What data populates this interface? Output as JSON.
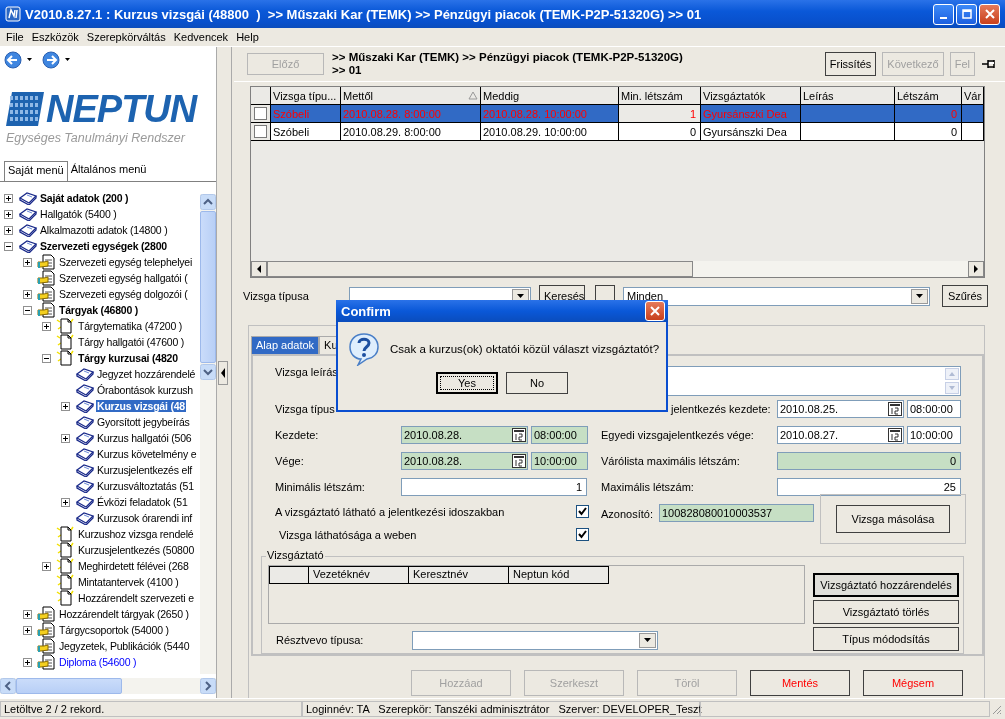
{
  "window": {
    "title": "V2010.8.27.1 : Kurzus vizsgái (48800  )  >> Műszaki Kar (TEMK) >> Pénzügyi piacok (TEMK-P2P-51320G) >> 01"
  },
  "menu": [
    "File",
    "Eszközök",
    "Szerepkörváltás",
    "Kedvencek",
    "Help"
  ],
  "logo": {
    "name": "NEPTUN",
    "tagline": "Egységes Tanulmányi Rendszer"
  },
  "menu_tabs": [
    {
      "label": "Saját menü",
      "selected": true
    },
    {
      "label": "Általános menü",
      "selected": false
    }
  ],
  "tree": [
    {
      "label": "Saját adatok (200  )",
      "kind": "book",
      "bold": true,
      "link": false,
      "expandable": true,
      "expanded": false,
      "selected": false
    },
    {
      "label": "Hallgatók (5400  )",
      "kind": "book",
      "bold": false,
      "link": false,
      "expandable": true,
      "expanded": false,
      "selected": false
    },
    {
      "label": "Alkalmazotti adatok (14800  )",
      "kind": "book",
      "bold": false,
      "link": false,
      "expandable": true,
      "expanded": false,
      "selected": false
    },
    {
      "label": "Szervezeti egységek (2800",
      "kind": "book",
      "bold": true,
      "link": false,
      "expandable": true,
      "expanded": true,
      "selected": false,
      "children": [
        {
          "label": "Szervezeti egység telephelyei",
          "kind": "doc-hand",
          "bold": false,
          "link": false,
          "expandable": true,
          "expanded": false,
          "selected": false
        },
        {
          "label": "Szervezeti egység hallgatói (",
          "kind": "doc-hand",
          "bold": false,
          "link": false,
          "expandable": false,
          "selected": false
        },
        {
          "label": "Szervezeti egység dolgozói (",
          "kind": "doc-hand",
          "bold": false,
          "link": false,
          "expandable": true,
          "expanded": false,
          "selected": false
        },
        {
          "label": "Tárgyak (46800  )",
          "kind": "doc-hand",
          "bold": true,
          "link": false,
          "expandable": true,
          "expanded": true,
          "selected": false,
          "children": [
            {
              "label": "Tárgytematika (47200  )",
              "kind": "page",
              "bold": false,
              "link": false,
              "expandable": true,
              "expanded": false,
              "selected": false
            },
            {
              "label": "Tárgy hallgatói (47600  )",
              "kind": "page",
              "bold": false,
              "link": false,
              "expandable": false,
              "selected": false
            },
            {
              "label": "Tárgy kurzusai (4820",
              "kind": "page",
              "bold": true,
              "link": false,
              "expandable": true,
              "expanded": true,
              "selected": false,
              "children": [
                {
                  "label": "Jegyzet hozzárendelé",
                  "kind": "book",
                  "bold": false,
                  "link": false,
                  "expandable": false,
                  "selected": false
                },
                {
                  "label": "Órabontások kurzush",
                  "kind": "book",
                  "bold": false,
                  "link": false,
                  "expandable": false,
                  "selected": false
                },
                {
                  "label": "Kurzus vizsgái (48",
                  "kind": "book",
                  "bold": true,
                  "link": false,
                  "expandable": true,
                  "expanded": false,
                  "selected": true
                },
                {
                  "label": "Gyorsított jegybeírás",
                  "kind": "book",
                  "bold": false,
                  "link": false,
                  "expandable": false,
                  "selected": false
                },
                {
                  "label": "Kurzus hallgatói (506",
                  "kind": "book",
                  "bold": false,
                  "link": false,
                  "expandable": true,
                  "expanded": false,
                  "selected": false
                },
                {
                  "label": "Kurzus követelmény e",
                  "kind": "book",
                  "bold": false,
                  "link": false,
                  "expandable": false,
                  "selected": false
                },
                {
                  "label": "Kurzusjelentkezés elf",
                  "kind": "book",
                  "bold": false,
                  "link": false,
                  "expandable": false,
                  "selected": false
                },
                {
                  "label": "Kurzusváltoztatás (51",
                  "kind": "book",
                  "bold": false,
                  "link": false,
                  "expandable": false,
                  "selected": false
                },
                {
                  "label": "Évközi feladatok (51",
                  "kind": "book",
                  "bold": false,
                  "link": false,
                  "expandable": true,
                  "expanded": false,
                  "selected": false
                },
                {
                  "label": "Kurzusok órarendi inf",
                  "kind": "book",
                  "bold": false,
                  "link": false,
                  "expandable": false,
                  "selected": false
                }
              ]
            },
            {
              "label": "Kurzushoz vizsga rendelé",
              "kind": "page",
              "bold": false,
              "link": false,
              "expandable": false,
              "selected": false
            },
            {
              "label": "Kurzusjelentkezés (50800",
              "kind": "page",
              "bold": false,
              "link": false,
              "expandable": false,
              "selected": false
            },
            {
              "label": "Meghirdetett félévei (268",
              "kind": "page",
              "bold": false,
              "link": false,
              "expandable": true,
              "expanded": false,
              "selected": false
            },
            {
              "label": "Mintatantervek (4100  )",
              "kind": "page",
              "bold": false,
              "link": false,
              "expandable": false,
              "selected": false
            },
            {
              "label": "Hozzárendelt szervezeti e",
              "kind": "page",
              "bold": false,
              "link": false,
              "expandable": false,
              "selected": false
            }
          ]
        },
        {
          "label": "Hozzárendelt tárgyak (2650  )",
          "kind": "doc-hand",
          "bold": false,
          "link": false,
          "expandable": true,
          "expanded": false,
          "selected": false
        },
        {
          "label": "Tárgycsoportok (54000  )",
          "kind": "doc-hand",
          "bold": false,
          "link": false,
          "expandable": true,
          "expanded": false,
          "selected": false
        },
        {
          "label": "Jegyzetek, Publikációk (5440",
          "kind": "doc-hand",
          "bold": false,
          "link": false,
          "expandable": false,
          "selected": false
        },
        {
          "label": "Diploma (54600  )",
          "kind": "doc-hand",
          "bold": false,
          "link": true,
          "expandable": true,
          "expanded": false,
          "selected": false
        }
      ]
    }
  ],
  "nav": {
    "prev": {
      "label": "Előző",
      "disabled": true
    },
    "breadcrumb": [
      ">> Műszaki Kar (TEMK) >> Pénzügyi piacok (TEMK-P2P-51320G)",
      ">> 01"
    ],
    "buttons": [
      {
        "label": "Frissítés",
        "disabled": false
      },
      {
        "label": "Következő",
        "disabled": true
      },
      {
        "label": "Fel",
        "disabled": true
      }
    ]
  },
  "grid": {
    "columns": [
      {
        "label": "Vizsga típu...",
        "sorted": false
      },
      {
        "label": "Mettől",
        "sorted": true
      },
      {
        "label": "Meddig",
        "sorted": false
      },
      {
        "label": "Min. létszám",
        "sorted": false
      },
      {
        "label": "Vizsgáztatók",
        "sorted": false
      },
      {
        "label": "Leírás",
        "sorted": false
      },
      {
        "label": "Létszám",
        "sorted": false
      },
      {
        "label": "Vár",
        "sorted": false
      }
    ],
    "rows": [
      {
        "selected": true,
        "checked": false,
        "type": "Szóbeli",
        "from": "2010.08.28. 8:00:00",
        "to": "2010.08.28. 10:00:00",
        "min": "1",
        "examiners": "Gyursánszki Dea",
        "count": "0"
      },
      {
        "selected": false,
        "checked": false,
        "type": "Szóbeli",
        "from": "2010.08.29. 8:00:00",
        "to": "2010.08.29. 10:00:00",
        "min": "0",
        "examiners": "Gyursánszki Dea",
        "count": "0"
      }
    ]
  },
  "filter": {
    "label": "Vizsga típusa",
    "search_button": "Keresés",
    "scope": "Minden",
    "filter_button": "Szűrés"
  },
  "form_tabs": [
    {
      "label": "Alap adatok",
      "selected": true
    },
    {
      "label": "Ku",
      "selected": false
    }
  ],
  "form": {
    "description_label": "Vizsga leírás",
    "type_label": "Vizsga típus",
    "start": {
      "label": "Kezdete:",
      "date": "2010.08.28.",
      "time": "08:00:00",
      "locked": true
    },
    "end": {
      "label": "Vége:",
      "date": "2010.08.28.",
      "time": "10:00:00",
      "locked": true
    },
    "min": {
      "label": "Minimális létszám:",
      "value": "1",
      "locked": false
    },
    "checks": [
      {
        "label": "A vizsgáztató látható a jelentkezési idoszakban",
        "checked": true
      },
      {
        "label": "Vizsga láthatósága a weben",
        "checked": true
      }
    ],
    "reg_start": {
      "label": "jelentkezés kezdete:",
      "date": "2010.08.25.",
      "time": "08:00:00",
      "locked": false
    },
    "reg_end": {
      "label": "Egyedi vizsgajelentkezés vége:",
      "date": "2010.08.27.",
      "time": "10:00:00",
      "locked": false
    },
    "waitlist": {
      "label": "Várólista maximális létszám:",
      "value": "0",
      "locked": true
    },
    "max": {
      "label": "Maximális létszám:",
      "value": "25",
      "locked": false
    },
    "id": {
      "label": "Azonosító:",
      "value": "100828080010003537",
      "locked": true
    },
    "copy_button": "Vizsga másolása"
  },
  "examiners": {
    "legend": "Vizsgáztató",
    "columns": [
      "Vezetéknév",
      "Keresztnév",
      "Neptun kód"
    ],
    "role_label": "Résztvevo típusa:",
    "buttons": [
      {
        "label": "Vizsgáztató hozzárendelés",
        "focused": true
      },
      {
        "label": "Vizsgáztató törlés",
        "focused": false
      },
      {
        "label": "Típus módodsítás",
        "focused": false
      }
    ]
  },
  "actions": [
    {
      "label": "Hozzáad",
      "disabled": true,
      "danger": false
    },
    {
      "label": "Szerkeszt",
      "disabled": true,
      "danger": false
    },
    {
      "label": "Töröl",
      "disabled": true,
      "danger": false
    },
    {
      "label": "Mentés",
      "disabled": false,
      "danger": true
    },
    {
      "label": "Mégsem",
      "disabled": false,
      "danger": true
    }
  ],
  "dialog": {
    "title": "Confirm",
    "message": "Csak a kurzus(ok) oktatói közül választ vizsgáztatót?",
    "buttons": [
      {
        "label": "Yes",
        "focused": true
      },
      {
        "label": "No",
        "focused": false
      }
    ]
  },
  "status_bar": [
    "Letöltve 2 / 2 rekord.",
    "Loginnév: TA   Szerepkör: Tanszéki adminisztrátor   Szerver: DEVELOPER_Teszt"
  ]
}
